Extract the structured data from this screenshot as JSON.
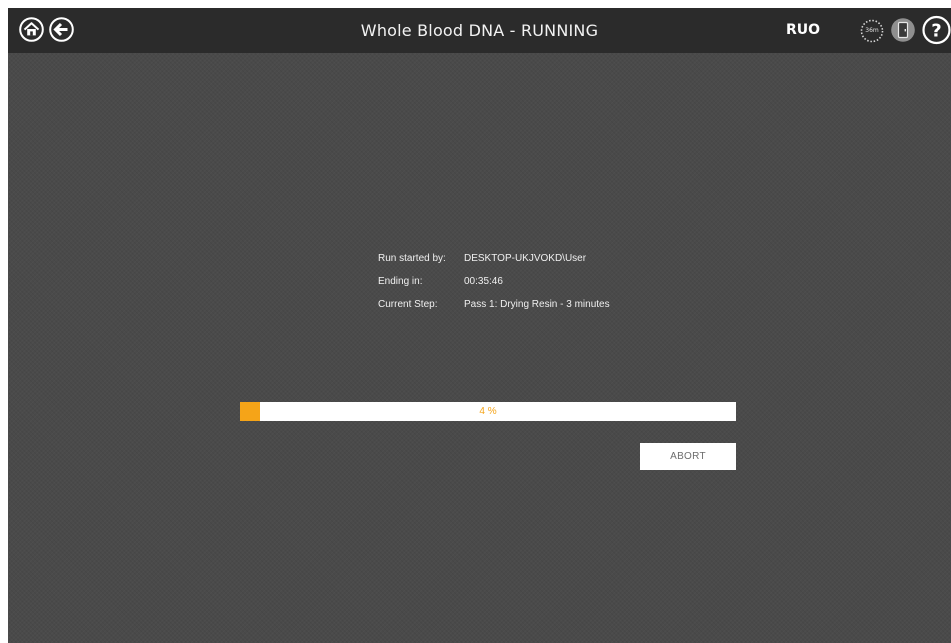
{
  "header": {
    "title": "Whole Blood DNA - RUNNING",
    "badge": "RUO",
    "timer_label": "36m",
    "icons": {
      "home": "home-icon",
      "back": "back-arrow-icon",
      "timer": "timer-icon",
      "door": "door-icon",
      "help": "help-icon"
    }
  },
  "run_info": {
    "started_by_label": "Run started by:",
    "started_by_value": "DESKTOP-UKJVOKD\\User",
    "ending_in_label": "Ending in:",
    "ending_in_value": "00:35:46",
    "current_step_label": "Current Step:",
    "current_step_value": "Pass 1: Drying Resin - 3 minutes"
  },
  "progress": {
    "percent": 4,
    "label": "4 %"
  },
  "actions": {
    "abort_label": "ABORT"
  },
  "colors": {
    "accent": "#f5a418",
    "background": "#4a4a4a",
    "header": "#2b2b2b"
  }
}
